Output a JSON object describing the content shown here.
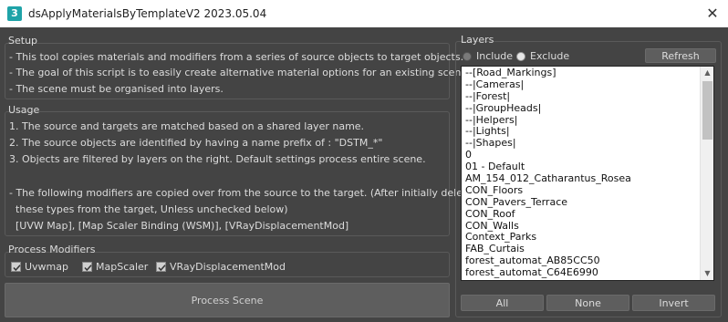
{
  "window": {
    "icon_label": "3",
    "title": "dsApplyMaterialsByTemplateV2 2023.05.04",
    "close_glyph": "✕"
  },
  "setup": {
    "label": "Setup",
    "lines": [
      "- This tool copies materials and modifiers from a series of source objects to target objects.",
      "- The goal of this script is to easily create alternative material options for an existing scene.",
      "- The scene must be organised into layers."
    ]
  },
  "usage": {
    "label": "Usage",
    "lines": [
      "1. The source and targets are matched based on a shared layer name.",
      "2. The source objects are identified by having a name prefix of : \"DSTM_*\"",
      "3. Objects are filtered by layers on the right. Default settings process entire scene.",
      "- The following modifiers are copied over from the source to the target. (After initially deleting",
      "these types from the target, Unless unchecked below)",
      "[UVW Map], [Map Scaler Binding (WSM)], [VRayDisplacementMod]"
    ]
  },
  "process_modifiers": {
    "label": "Process Modifiers",
    "options": [
      {
        "label": "Uvwmap",
        "checked": true
      },
      {
        "label": "MapScaler",
        "checked": true
      },
      {
        "label": "VRayDisplacementMod",
        "checked": true
      }
    ]
  },
  "process_button": "Process Scene",
  "layers": {
    "label": "Layers",
    "include_label": "Include",
    "exclude_label": "Exclude",
    "selected_mode": "Exclude",
    "refresh_label": "Refresh",
    "items": [
      "--[Road_Markings]",
      "--|Cameras|",
      "--|Forest|",
      "--|GroupHeads|",
      "--|Helpers|",
      "--|Lights|",
      "--|Shapes|",
      "0",
      "01 - Default",
      "AM_154_012_Catharantus_Rosea",
      "CON_Floors",
      "CON_Pavers_Terrace",
      "CON_Roof",
      "CON_Walls",
      "Context_Parks",
      "FAB_Curtais",
      "forest_automat_AB85CC50",
      "forest_automat_C64E6990"
    ],
    "all_label": "All",
    "none_label": "None",
    "invert_label": "Invert"
  },
  "colors": {
    "background": "#444444",
    "titlebar": "#ffffff",
    "app_icon": "#1fa3a8",
    "button": "#5e5e5e",
    "listbox": "#ffffff"
  }
}
